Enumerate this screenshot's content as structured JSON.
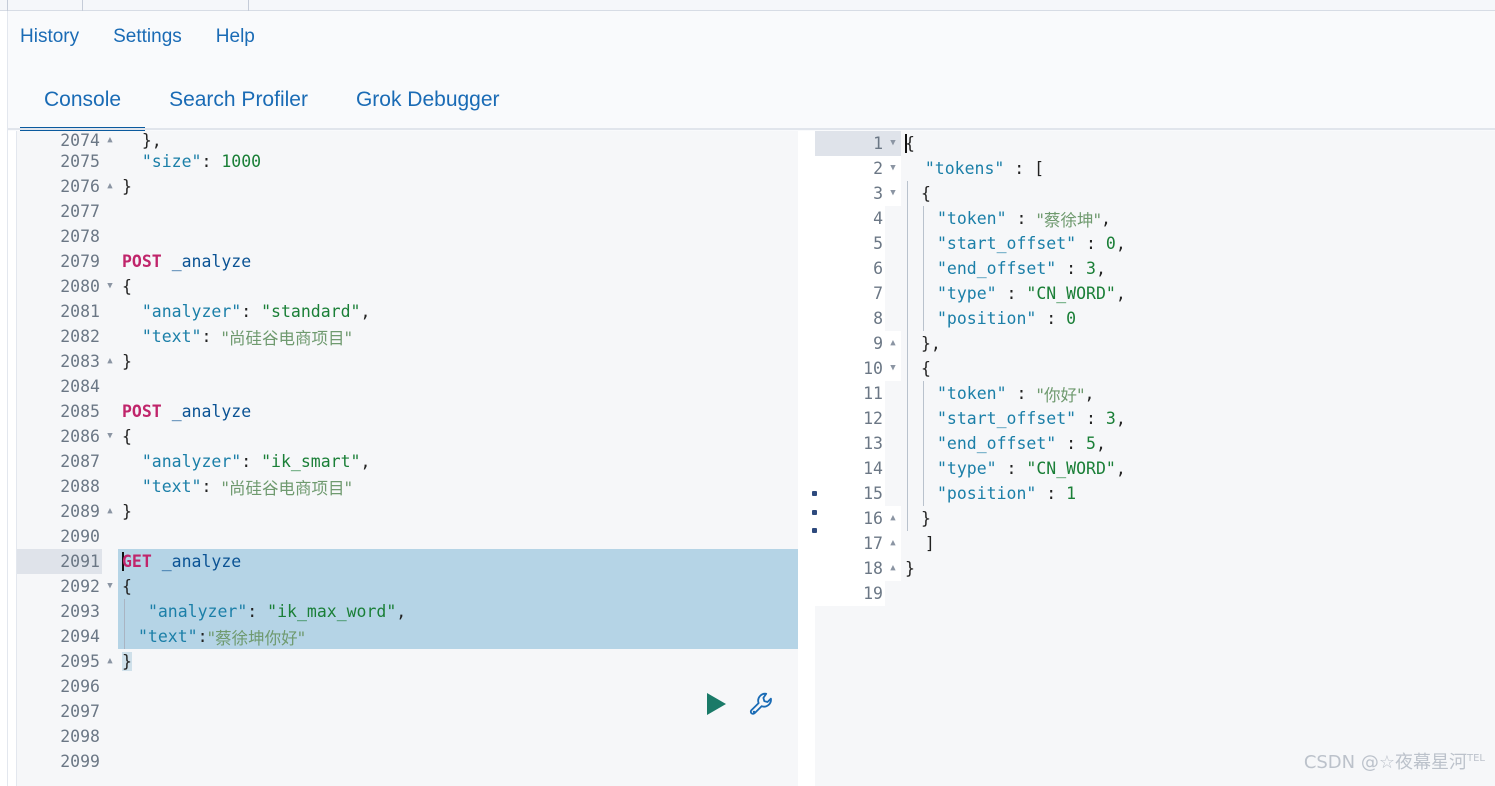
{
  "header": {
    "nav_links": [
      {
        "label": "History",
        "name": "history"
      },
      {
        "label": "Settings",
        "name": "settings"
      },
      {
        "label": "Help",
        "name": "help"
      }
    ],
    "tabs": [
      {
        "label": "Console",
        "active": true
      },
      {
        "label": "Search Profiler",
        "active": false
      },
      {
        "label": "Grok Debugger",
        "active": false
      }
    ]
  },
  "colors": {
    "accent": "#0b5a9e",
    "link": "#1a6bb5",
    "method": "#c0256b",
    "key": "#1b7fa8",
    "string": "#1a7f37",
    "cjk_string": "#6f9a6f",
    "selection": "#b5d4e6",
    "active_line_gutter": "#dfe3ea",
    "play_icon": "#1a7a68",
    "wrench_icon": "#1a6bb5",
    "watermark": "#bcc2cb"
  },
  "editor": {
    "first_line_number": 2074,
    "active_line": 2091,
    "selection_start_line": 2091,
    "selection_end_line": 2095,
    "lines": [
      {
        "n": 2074,
        "fold": "up",
        "clipped": true,
        "tokens": [
          {
            "t": "  },",
            "c": "pun"
          }
        ]
      },
      {
        "n": 2075,
        "fold": "",
        "tokens": [
          {
            "t": "  ",
            "c": "pun"
          },
          {
            "t": "\"size\"",
            "c": "key"
          },
          {
            "t": ": ",
            "c": "pun"
          },
          {
            "t": "1000",
            "c": "num"
          }
        ]
      },
      {
        "n": 2076,
        "fold": "up",
        "tokens": [
          {
            "t": "}",
            "c": "pun"
          }
        ]
      },
      {
        "n": 2077,
        "fold": "",
        "tokens": []
      },
      {
        "n": 2078,
        "fold": "",
        "tokens": []
      },
      {
        "n": 2079,
        "fold": "",
        "tokens": [
          {
            "t": "POST",
            "c": "m"
          },
          {
            "t": " ",
            "c": "pun"
          },
          {
            "t": "_analyze",
            "c": "url"
          }
        ]
      },
      {
        "n": 2080,
        "fold": "down",
        "tokens": [
          {
            "t": "{",
            "c": "pun"
          }
        ]
      },
      {
        "n": 2081,
        "fold": "",
        "tokens": [
          {
            "t": "  ",
            "c": "pun"
          },
          {
            "t": "\"analyzer\"",
            "c": "key"
          },
          {
            "t": ": ",
            "c": "pun"
          },
          {
            "t": "\"standard\"",
            "c": "str"
          },
          {
            "t": ",",
            "c": "pun"
          }
        ]
      },
      {
        "n": 2082,
        "fold": "",
        "tokens": [
          {
            "t": "  ",
            "c": "pun"
          },
          {
            "t": "\"text\"",
            "c": "key"
          },
          {
            "t": ": ",
            "c": "pun"
          },
          {
            "t": "\"尚硅谷电商项目\"",
            "c": "cjk"
          }
        ]
      },
      {
        "n": 2083,
        "fold": "up",
        "tokens": [
          {
            "t": "}",
            "c": "pun"
          }
        ]
      },
      {
        "n": 2084,
        "fold": "",
        "tokens": []
      },
      {
        "n": 2085,
        "fold": "",
        "tokens": [
          {
            "t": "POST",
            "c": "m"
          },
          {
            "t": " ",
            "c": "pun"
          },
          {
            "t": "_analyze",
            "c": "url"
          }
        ]
      },
      {
        "n": 2086,
        "fold": "down",
        "tokens": [
          {
            "t": "{",
            "c": "pun"
          }
        ]
      },
      {
        "n": 2087,
        "fold": "",
        "tokens": [
          {
            "t": "  ",
            "c": "pun"
          },
          {
            "t": "\"analyzer\"",
            "c": "key"
          },
          {
            "t": ": ",
            "c": "pun"
          },
          {
            "t": "\"ik_smart\"",
            "c": "str"
          },
          {
            "t": ",",
            "c": "pun"
          }
        ]
      },
      {
        "n": 2088,
        "fold": "",
        "tokens": [
          {
            "t": "  ",
            "c": "pun"
          },
          {
            "t": "\"text\"",
            "c": "key"
          },
          {
            "t": ": ",
            "c": "pun"
          },
          {
            "t": "\"尚硅谷电商项目\"",
            "c": "cjk"
          }
        ]
      },
      {
        "n": 2089,
        "fold": "up",
        "tokens": [
          {
            "t": "}",
            "c": "pun"
          }
        ]
      },
      {
        "n": 2090,
        "fold": "",
        "tokens": []
      },
      {
        "n": 2091,
        "fold": "",
        "caret": true,
        "sel": true,
        "tokens": [
          {
            "t": "GET",
            "c": "m"
          },
          {
            "t": " ",
            "c": "pun"
          },
          {
            "t": "_analyze",
            "c": "url"
          }
        ]
      },
      {
        "n": 2092,
        "fold": "down",
        "sel": true,
        "tokens": [
          {
            "t": "{",
            "c": "pun"
          }
        ]
      },
      {
        "n": 2093,
        "fold": "",
        "sel": true,
        "guide": true,
        "tokens": [
          {
            "t": " ",
            "c": "pun"
          },
          {
            "t": "\"analyzer\"",
            "c": "key"
          },
          {
            "t": ": ",
            "c": "pun"
          },
          {
            "t": "\"ik_max_word\"",
            "c": "str"
          },
          {
            "t": ",",
            "c": "pun"
          }
        ]
      },
      {
        "n": 2094,
        "fold": "",
        "sel": true,
        "guide": true,
        "tokens": [
          {
            "t": "\"text\"",
            "c": "key"
          },
          {
            "t": ":",
            "c": "pun"
          },
          {
            "t": "\"蔡徐坤你好\"",
            "c": "cjk"
          }
        ]
      },
      {
        "n": 2095,
        "fold": "up",
        "selPartial": true,
        "tokens": [
          {
            "t": "}",
            "c": "pun"
          }
        ]
      },
      {
        "n": 2096,
        "fold": "",
        "tokens": []
      },
      {
        "n": 2097,
        "fold": "",
        "tokens": []
      },
      {
        "n": 2098,
        "fold": "",
        "tokens": []
      },
      {
        "n": 2099,
        "fold": "",
        "tokens": []
      }
    ],
    "actions": [
      {
        "name": "run-request-button",
        "icon": "play-icon",
        "title": "Click to send request"
      },
      {
        "name": "open-documentation-button",
        "icon": "wrench-icon",
        "title": "Open documentation"
      }
    ]
  },
  "output": {
    "active_line": 1,
    "lines": [
      {
        "n": 1,
        "fold": "down",
        "active": true,
        "caret": true,
        "tokens": [
          {
            "t": "{",
            "c": "pun"
          }
        ]
      },
      {
        "n": 2,
        "fold": "down",
        "tokens": [
          {
            "t": "  ",
            "c": "pun"
          },
          {
            "t": "\"tokens\"",
            "c": "key"
          },
          {
            "t": " : ",
            "c": "pun"
          },
          {
            "t": "[",
            "c": "pun"
          }
        ]
      },
      {
        "n": 3,
        "fold": "down",
        "g": 1,
        "tokens": [
          {
            "t": "{",
            "c": "pun"
          }
        ]
      },
      {
        "n": 4,
        "fold": "",
        "g": 2,
        "tokens": [
          {
            "t": "\"token\"",
            "c": "key"
          },
          {
            "t": " : ",
            "c": "pun"
          },
          {
            "t": "\"蔡徐坤\"",
            "c": "cjk"
          },
          {
            "t": ",",
            "c": "pun"
          }
        ]
      },
      {
        "n": 5,
        "fold": "",
        "g": 2,
        "tokens": [
          {
            "t": "\"start_offset\"",
            "c": "key"
          },
          {
            "t": " : ",
            "c": "pun"
          },
          {
            "t": "0",
            "c": "num"
          },
          {
            "t": ",",
            "c": "pun"
          }
        ]
      },
      {
        "n": 6,
        "fold": "",
        "g": 2,
        "tokens": [
          {
            "t": "\"end_offset\"",
            "c": "key"
          },
          {
            "t": " : ",
            "c": "pun"
          },
          {
            "t": "3",
            "c": "num"
          },
          {
            "t": ",",
            "c": "pun"
          }
        ]
      },
      {
        "n": 7,
        "fold": "",
        "g": 2,
        "tokens": [
          {
            "t": "\"type\"",
            "c": "key"
          },
          {
            "t": " : ",
            "c": "pun"
          },
          {
            "t": "\"CN_WORD\"",
            "c": "str"
          },
          {
            "t": ",",
            "c": "pun"
          }
        ]
      },
      {
        "n": 8,
        "fold": "",
        "g": 2,
        "tokens": [
          {
            "t": "\"position\"",
            "c": "key"
          },
          {
            "t": " : ",
            "c": "pun"
          },
          {
            "t": "0",
            "c": "num"
          }
        ]
      },
      {
        "n": 9,
        "fold": "up",
        "g": 1,
        "tokens": [
          {
            "t": "},",
            "c": "pun"
          }
        ]
      },
      {
        "n": 10,
        "fold": "down",
        "g": 1,
        "tokens": [
          {
            "t": "{",
            "c": "pun"
          }
        ]
      },
      {
        "n": 11,
        "fold": "",
        "g": 2,
        "tokens": [
          {
            "t": "\"token\"",
            "c": "key"
          },
          {
            "t": " : ",
            "c": "pun"
          },
          {
            "t": "\"你好\"",
            "c": "cjk"
          },
          {
            "t": ",",
            "c": "pun"
          }
        ]
      },
      {
        "n": 12,
        "fold": "",
        "g": 2,
        "tokens": [
          {
            "t": "\"start_offset\"",
            "c": "key"
          },
          {
            "t": " : ",
            "c": "pun"
          },
          {
            "t": "3",
            "c": "num"
          },
          {
            "t": ",",
            "c": "pun"
          }
        ]
      },
      {
        "n": 13,
        "fold": "",
        "g": 2,
        "tokens": [
          {
            "t": "\"end_offset\"",
            "c": "key"
          },
          {
            "t": " : ",
            "c": "pun"
          },
          {
            "t": "5",
            "c": "num"
          },
          {
            "t": ",",
            "c": "pun"
          }
        ]
      },
      {
        "n": 14,
        "fold": "",
        "g": 2,
        "tokens": [
          {
            "t": "\"type\"",
            "c": "key"
          },
          {
            "t": " : ",
            "c": "pun"
          },
          {
            "t": "\"CN_WORD\"",
            "c": "str"
          },
          {
            "t": ",",
            "c": "pun"
          }
        ]
      },
      {
        "n": 15,
        "fold": "",
        "g": 2,
        "tokens": [
          {
            "t": "\"position\"",
            "c": "key"
          },
          {
            "t": " : ",
            "c": "pun"
          },
          {
            "t": "1",
            "c": "num"
          }
        ]
      },
      {
        "n": 16,
        "fold": "up",
        "g": 1,
        "tokens": [
          {
            "t": "}",
            "c": "pun"
          }
        ]
      },
      {
        "n": 17,
        "fold": "up",
        "tokens": [
          {
            "t": "  ",
            "c": "pun"
          },
          {
            "t": "]",
            "c": "pun"
          }
        ]
      },
      {
        "n": 18,
        "fold": "up",
        "tokens": [
          {
            "t": "}",
            "c": "pun"
          }
        ]
      },
      {
        "n": 19,
        "fold": "",
        "tokens": []
      }
    ]
  },
  "watermark": {
    "text": "CSDN @☆夜幕星河",
    "sup": "TEL"
  }
}
